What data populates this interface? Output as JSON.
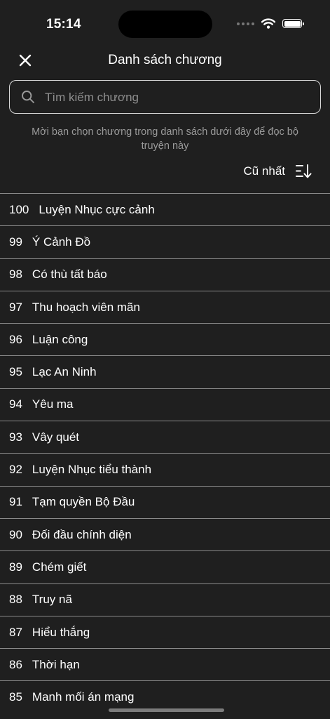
{
  "status_bar": {
    "time": "15:14"
  },
  "header": {
    "title": "Danh sách chương"
  },
  "search": {
    "placeholder": "Tìm kiếm chương",
    "value": ""
  },
  "hint": "Mời bạn chọn chương trong danh sách dưới đây để đọc bộ truyện này",
  "sort": {
    "label": "Cũ nhất"
  },
  "chapters": [
    {
      "number": "100",
      "title": "Luyện Nhục cực cảnh"
    },
    {
      "number": "99",
      "title": "Ý Cảnh Đồ"
    },
    {
      "number": "98",
      "title": "Có thù tất báo"
    },
    {
      "number": "97",
      "title": "Thu hoạch viên mãn"
    },
    {
      "number": "96",
      "title": "Luận công"
    },
    {
      "number": "95",
      "title": "Lạc An Ninh"
    },
    {
      "number": "94",
      "title": "Yêu ma"
    },
    {
      "number": "93",
      "title": "Vây quét"
    },
    {
      "number": "92",
      "title": "Luyện Nhục tiểu thành"
    },
    {
      "number": "91",
      "title": "Tạm quyền Bộ Đầu"
    },
    {
      "number": "90",
      "title": "Đối đầu chính diện"
    },
    {
      "number": "89",
      "title": "Chém giết"
    },
    {
      "number": "88",
      "title": "Truy nã"
    },
    {
      "number": "87",
      "title": "Hiểu thắng"
    },
    {
      "number": "86",
      "title": "Thời hạn"
    },
    {
      "number": "85",
      "title": "Manh mối án mạng"
    }
  ]
}
